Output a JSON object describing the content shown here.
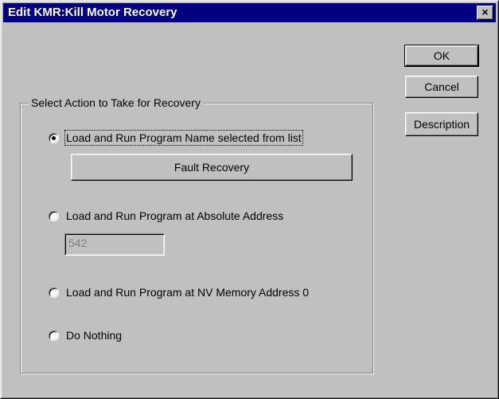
{
  "window": {
    "title": "Edit KMR:Kill Motor Recovery",
    "close_label": "×"
  },
  "buttons": {
    "ok": "OK",
    "cancel": "Cancel",
    "description": "Description"
  },
  "group": {
    "label": "Select Action to Take for Recovery",
    "options": [
      {
        "label": "Load and Run Program Name selected from list",
        "selected": true
      },
      {
        "label": "Load and Run Program at Absolute Address",
        "selected": false
      },
      {
        "label": "Load and Run Program at NV Memory Address 0",
        "selected": false
      },
      {
        "label": "Do Nothing",
        "selected": false
      }
    ],
    "program_button": "Fault Recovery",
    "address_value": "542"
  }
}
